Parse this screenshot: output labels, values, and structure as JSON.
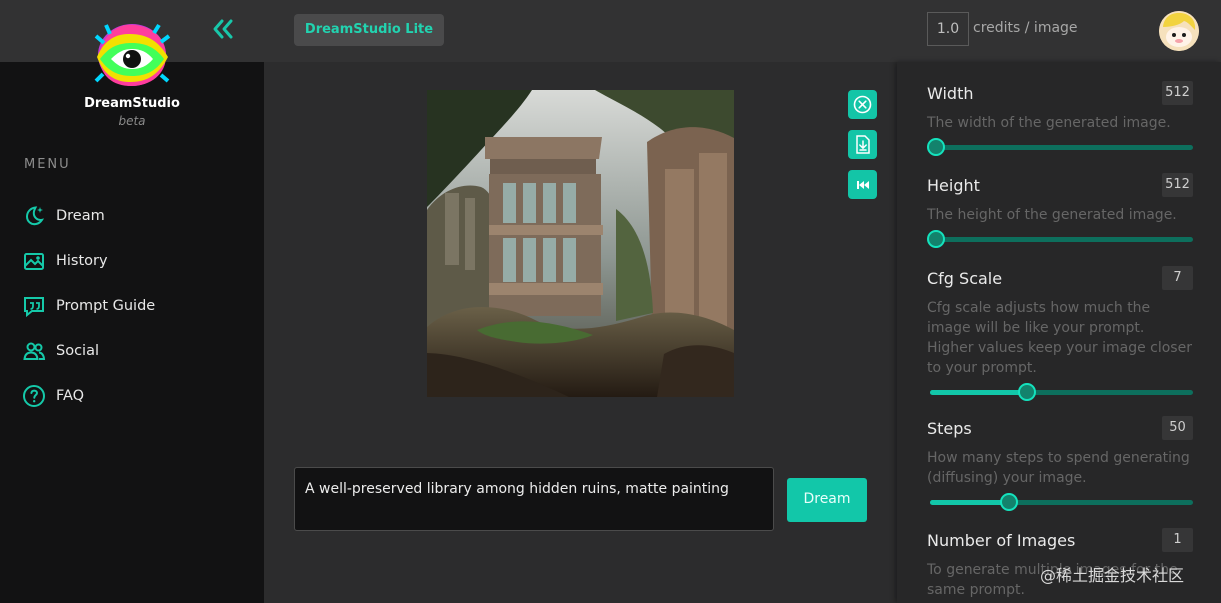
{
  "app": {
    "brand": "DreamStudio",
    "beta_label": "beta",
    "lite_label": "DreamStudio Lite"
  },
  "sidebar": {
    "menu_title": "MENU",
    "items": [
      {
        "label": "Dream",
        "icon": "moon-star-icon"
      },
      {
        "label": "History",
        "icon": "image-gallery-icon"
      },
      {
        "label": "Prompt Guide",
        "icon": "quote-bubble-icon"
      },
      {
        "label": "Social",
        "icon": "users-icon"
      },
      {
        "label": "FAQ",
        "icon": "question-circle-icon"
      }
    ]
  },
  "header": {
    "credits_value": "1.0",
    "credits_label": "credits / image"
  },
  "main": {
    "image_alt": "Generated image of overgrown library ruins",
    "prompt_text": "A well-preserved library among hidden ruins, matte painting",
    "dream_button": "Dream",
    "tools": [
      "close-circle-icon",
      "download-icon",
      "rewind-icon"
    ]
  },
  "settings": {
    "width": {
      "title": "Width",
      "value": "512",
      "description": "The width of the generated image.",
      "slider_fraction": 0.0
    },
    "height": {
      "title": "Height",
      "value": "512",
      "description": "The height of the generated image.",
      "slider_fraction": 0.0
    },
    "cfg_scale": {
      "title": "Cfg Scale",
      "value": "7",
      "description": "Cfg scale adjusts how much the image will be like your prompt. Higher values keep your image closer to your prompt.",
      "slider_fraction": 0.35
    },
    "steps": {
      "title": "Steps",
      "value": "50",
      "description": "How many steps to spend generating (diffusing) your image.",
      "slider_fraction": 0.28
    },
    "images": {
      "title": "Number of Images",
      "value": "1",
      "description": "To generate multiple images for the same prompt."
    }
  },
  "watermark": "@稀土掘金技术社区",
  "colors": {
    "accent": "#12c7a9",
    "sidebar": "#121213",
    "panel": "#272728"
  }
}
